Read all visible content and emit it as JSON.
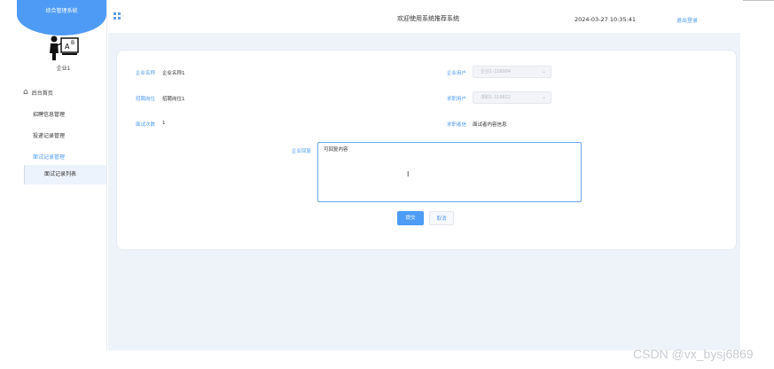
{
  "sidebar": {
    "system_name": "综合管理系统",
    "username": "企业1",
    "home_label": "后台首页",
    "items": [
      {
        "label": "招聘信息管理"
      },
      {
        "label": "投递记录管理"
      },
      {
        "label": "面试记录管理"
      }
    ],
    "submenu_label": "面试记录列表"
  },
  "header": {
    "title": "欢迎使用系统推荐系统",
    "datetime": "2024-03-27 10:35:41",
    "exit_label": "退出登录"
  },
  "form": {
    "company_name_label": "企业名称",
    "company_name_value": "企业名称1",
    "company_user_label": "企业用户",
    "company_user_value": "企业1-226984",
    "position_label": "招聘岗位",
    "position_value": "招聘岗位1",
    "job_user_label": "求职用户",
    "job_user_value": "求职1-318822",
    "interview_count_label": "面试次数",
    "interview_count_value": "1",
    "interview_content_label": "求职者信",
    "interview_content_value": "面试者内容信息",
    "reply_label": "企业回复",
    "reply_value": "可回复内容"
  },
  "buttons": {
    "submit_label": "提交",
    "cancel_label": "取消"
  },
  "watermark": "CSDN @vx_bysj6869",
  "colors": {
    "accent": "#4e9bf5",
    "content_bg": "#eef3f9"
  }
}
